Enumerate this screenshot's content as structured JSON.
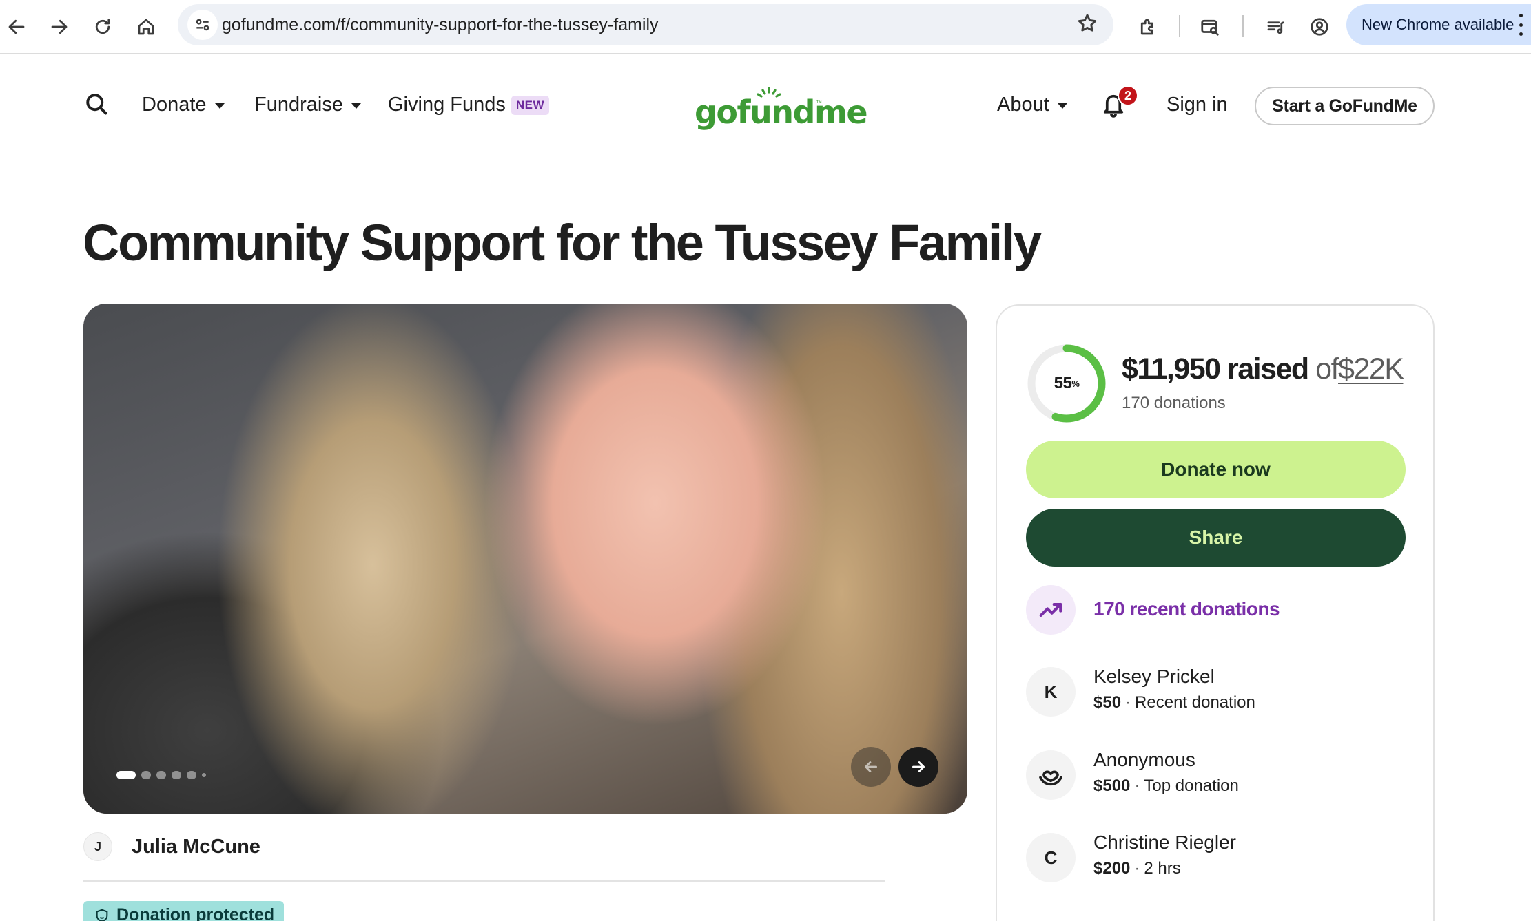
{
  "browser": {
    "url": "gofundme.com/f/community-support-for-the-tussey-family",
    "update_label": "New Chrome available"
  },
  "header": {
    "nav": {
      "donate": "Donate",
      "fundraise": "Fundraise",
      "giving_funds": "Giving Funds",
      "new_badge": "NEW"
    },
    "logo_text": "gofundme",
    "logo_tm": "™",
    "about": "About",
    "notification_count": "2",
    "sign_in": "Sign in",
    "start_button": "Start a GoFundMe"
  },
  "campaign": {
    "title": "Community Support for the Tussey Family",
    "slide_count": 6,
    "active_slide": 1,
    "organizer_initial": "J",
    "organizer_name": "Julia McCune",
    "protected_label": "Donation protected"
  },
  "donation_card": {
    "progress_percent": "55",
    "progress_fraction": 0.55,
    "percent_sign": "%",
    "raised_amount": "$11,950 raised",
    "of_label": "of",
    "goal": "$22K",
    "donation_count": "170 donations",
    "donate_button": "Donate now",
    "share_button": "Share",
    "recent_link": "170 recent donations",
    "donors": [
      {
        "initial": "K",
        "name": "Kelsey Prickel",
        "amount": "$50",
        "detail": "Recent donation"
      },
      {
        "initial": "",
        "icon": "heart-hands-icon",
        "name": "Anonymous",
        "amount": "$500",
        "detail": "Top donation"
      },
      {
        "initial": "C",
        "name": "Christine Riegler",
        "amount": "$200",
        "detail": "2 hrs"
      }
    ]
  },
  "colors": {
    "brand_green": "#3d9b35",
    "donate_button": "#cdf28f",
    "share_button": "#1e4a32",
    "recent_purple": "#7a2fa8",
    "progress_ring": "#5bbf45",
    "notification_red": "#c2141a",
    "protected_badge": "#9fe0dc"
  }
}
